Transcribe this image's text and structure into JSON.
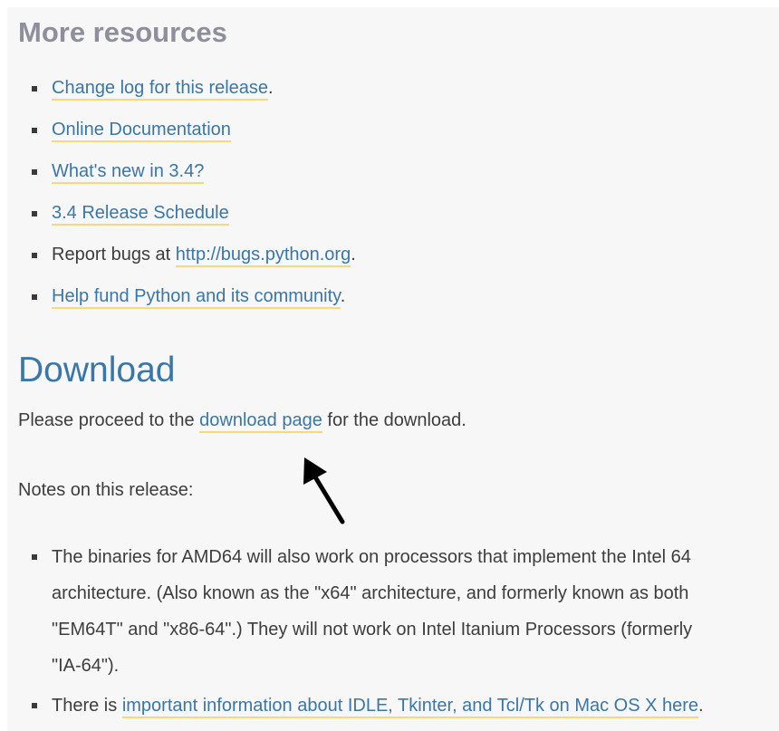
{
  "resources": {
    "title": "More resources",
    "items": [
      {
        "link": "Change log for this release",
        "after": "."
      },
      {
        "link": "Online Documentation",
        "after": ""
      },
      {
        "link": "What's new in 3.4?",
        "after": ""
      },
      {
        "link": "3.4 Release Schedule",
        "after": ""
      },
      {
        "before": "Report bugs at ",
        "link": "http://bugs.python.org",
        "after": "."
      },
      {
        "link": "Help fund Python and its community",
        "after": "."
      }
    ]
  },
  "download": {
    "title": "Download",
    "proceed_before": "Please proceed to the ",
    "proceed_link": "download page",
    "proceed_after": " for the download.",
    "notes_label": "Notes on this release:",
    "notes": [
      {
        "lines": [
          "The binaries for AMD64 will also work on processors that implement the Intel 64",
          "architecture. (Also known as the \"x64\" architecture, and formerly known as both",
          "\"EM64T\" and \"x86-64\".) They will not work on Intel Itanium Processors (formerly",
          "\"IA-64\")."
        ]
      },
      {
        "before": "There is ",
        "link": "important information about IDLE, Tkinter, and Tcl/Tk on Mac OS X here",
        "after": "."
      }
    ]
  },
  "colors": {
    "link": "#3a76a8",
    "link_underline": "#fcd77a",
    "heading_gray": "#8f8f9c",
    "text": "#3d3d3d",
    "background": "#f7f7f7"
  }
}
